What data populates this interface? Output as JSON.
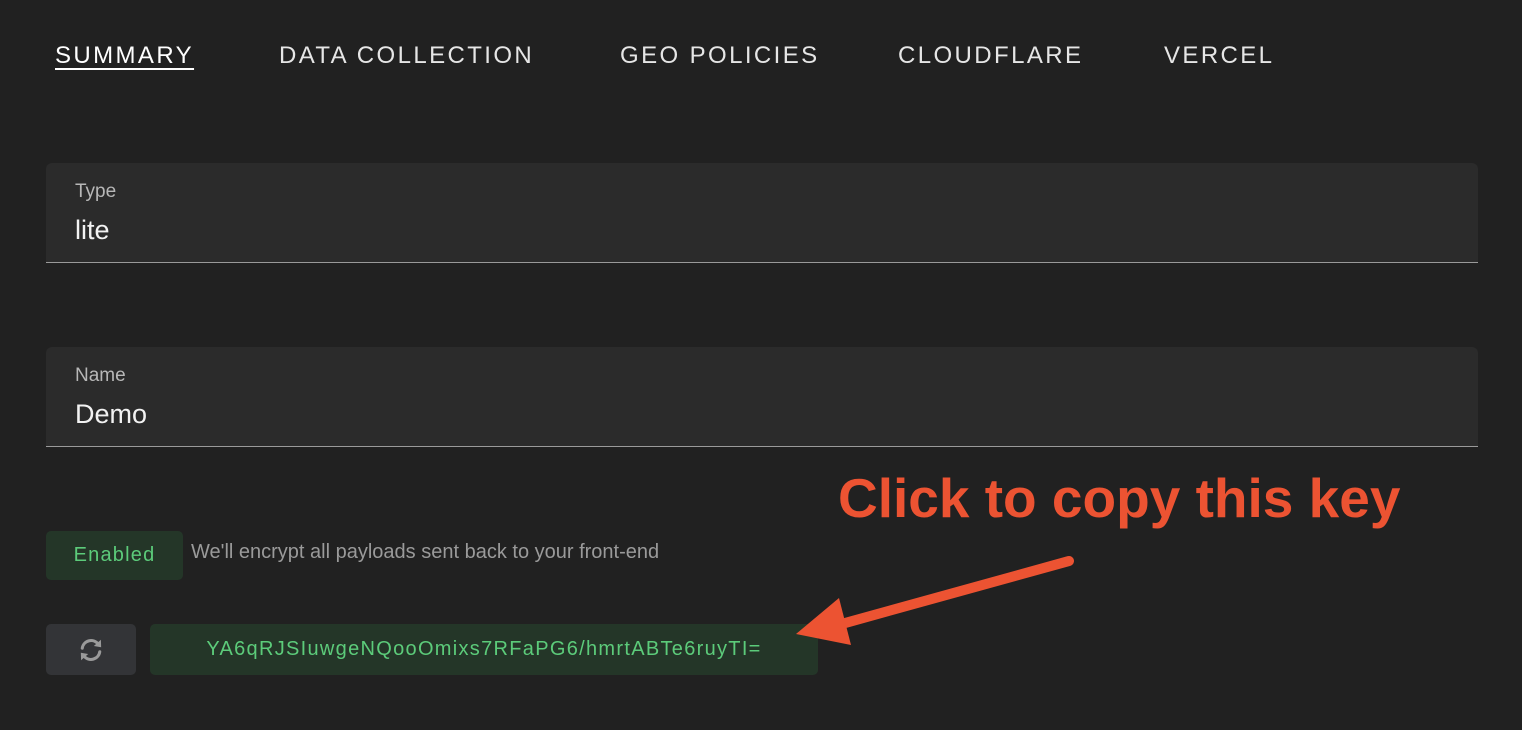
{
  "tabs": [
    {
      "label": "SUMMARY",
      "active": true
    },
    {
      "label": "DATA COLLECTION",
      "active": false
    },
    {
      "label": "GEO POLICIES",
      "active": false
    },
    {
      "label": "CLOUDFLARE",
      "active": false
    },
    {
      "label": "VERCEL",
      "active": false
    }
  ],
  "fields": {
    "type": {
      "label": "Type",
      "value": "lite"
    },
    "name": {
      "label": "Name",
      "value": "Demo"
    }
  },
  "encryption": {
    "status_label": "Enabled",
    "hint": "We'll encrypt all payloads sent back to your front-end",
    "key": "YA6qRJSIuwgeNQooOmixs7RFaPG6/hmrtABTe6ruyTI=",
    "refresh_icon": "refresh-icon"
  },
  "annotation": {
    "text": "Click to copy this key",
    "arrow_icon": "arrow-icon"
  },
  "colors": {
    "background": "#212121",
    "field_bg": "#2b2b2b",
    "success_green": "#5ccb7a",
    "success_bg": "#243628",
    "annotation_red": "#ec5332"
  }
}
